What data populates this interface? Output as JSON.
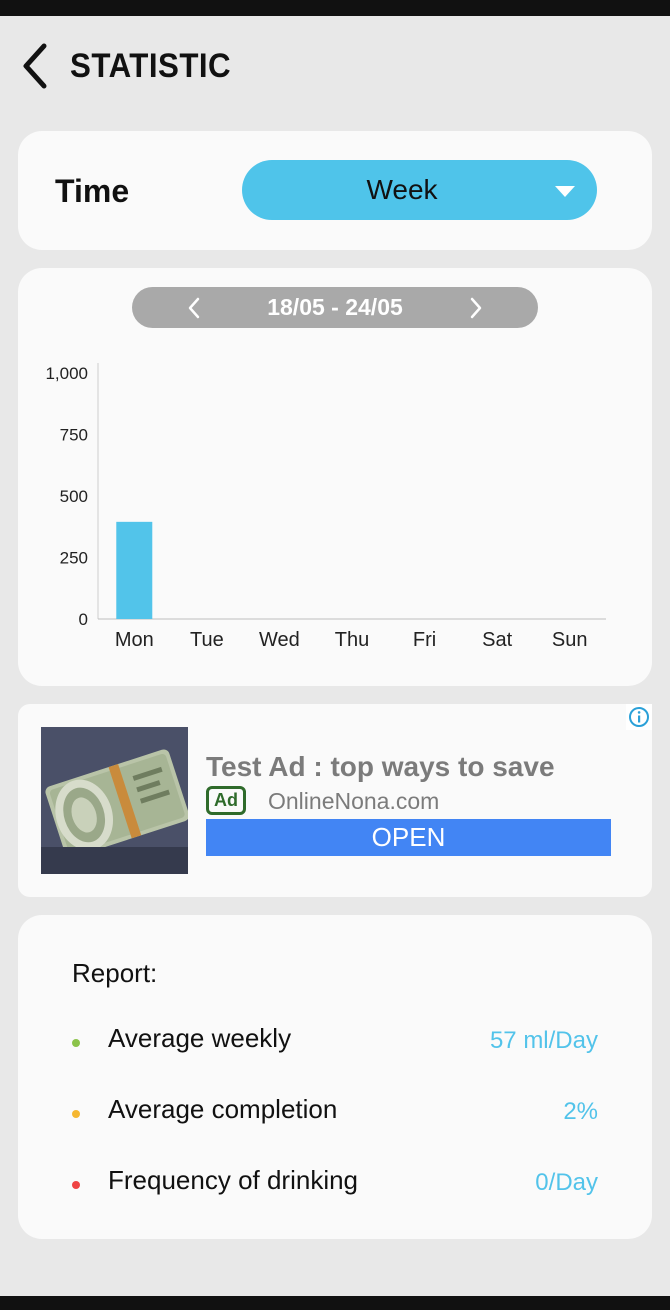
{
  "header": {
    "title": "STATISTIC",
    "back_icon": "chevron-left-icon"
  },
  "time_filter": {
    "label": "Time",
    "selected": "Week",
    "arrow_icon": "triangle-down-icon"
  },
  "date_range": {
    "text": "18/05 - 24/05",
    "prev_icon": "chevron-left-icon",
    "next_icon": "chevron-right-icon"
  },
  "chart_data": {
    "type": "bar",
    "categories": [
      "Mon",
      "Tue",
      "Wed",
      "Thu",
      "Fri",
      "Sat",
      "Sun"
    ],
    "values": [
      395,
      0,
      0,
      0,
      0,
      0,
      0
    ],
    "yticks": [
      "0",
      "250",
      "500",
      "750",
      "1,000"
    ],
    "ylim": [
      0,
      1000
    ],
    "title": "",
    "xlabel": "",
    "ylabel": "",
    "grid": false,
    "bar_color": "#52c4ea"
  },
  "ad": {
    "title": "Test Ad : top ways to save",
    "badge": "Ad",
    "domain": "OnlineNona.com",
    "cta": "OPEN",
    "info_icon": "info-icon"
  },
  "report": {
    "title": "Report:",
    "items": [
      {
        "label": "Average weekly",
        "value": "57 ml/Day",
        "dot_color": "#8bc34a"
      },
      {
        "label": "Average completion",
        "value": "2%",
        "dot_color": "#f5b731"
      },
      {
        "label": "Frequency of drinking",
        "value": "0/Day",
        "dot_color": "#ef4444"
      }
    ]
  },
  "colors": {
    "accent": "#52c4ea",
    "ad_button": "#4285f4",
    "ad_badge": "#2f6b2b"
  }
}
